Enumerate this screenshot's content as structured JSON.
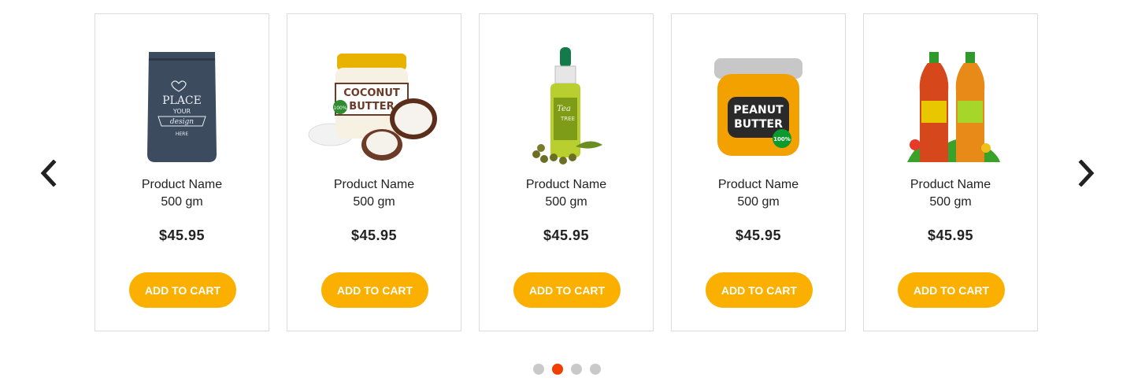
{
  "carousel": {
    "prev_icon": "chevron-left-icon",
    "next_icon": "chevron-right-icon",
    "products": [
      {
        "name": "Product Name",
        "weight": "500 gm",
        "price": "$45.95",
        "button": "ADD TO CART",
        "image": "coffee-pouch-image",
        "image_text": [
          "PLACE",
          "YOUR",
          "design",
          "HERE"
        ]
      },
      {
        "name": "Product Name",
        "weight": "500 gm",
        "price": "$45.95",
        "button": "ADD TO CART",
        "image": "coconut-butter-jar-image",
        "image_text": [
          "COCONUT",
          "BUTTER",
          "100%"
        ]
      },
      {
        "name": "Product Name",
        "weight": "500 gm",
        "price": "$45.95",
        "button": "ADD TO CART",
        "image": "tea-tree-oil-bottle-image",
        "image_text": [
          "Tea",
          "TREE"
        ]
      },
      {
        "name": "Product Name",
        "weight": "500 gm",
        "price": "$45.95",
        "button": "ADD TO CART",
        "image": "peanut-butter-jar-image",
        "image_text": [
          "PEANUT",
          "BUTTER",
          "100%"
        ]
      },
      {
        "name": "Product Name",
        "weight": "500 gm",
        "price": "$45.95",
        "button": "ADD TO CART",
        "image": "juice-bottles-image",
        "image_text": []
      }
    ],
    "dots": {
      "count": 4,
      "active_index": 1
    },
    "colors": {
      "button": "#fbb000",
      "active_dot": "#f23c00",
      "inactive_dot": "#c9c9c9",
      "border": "#dcdcdc"
    }
  }
}
